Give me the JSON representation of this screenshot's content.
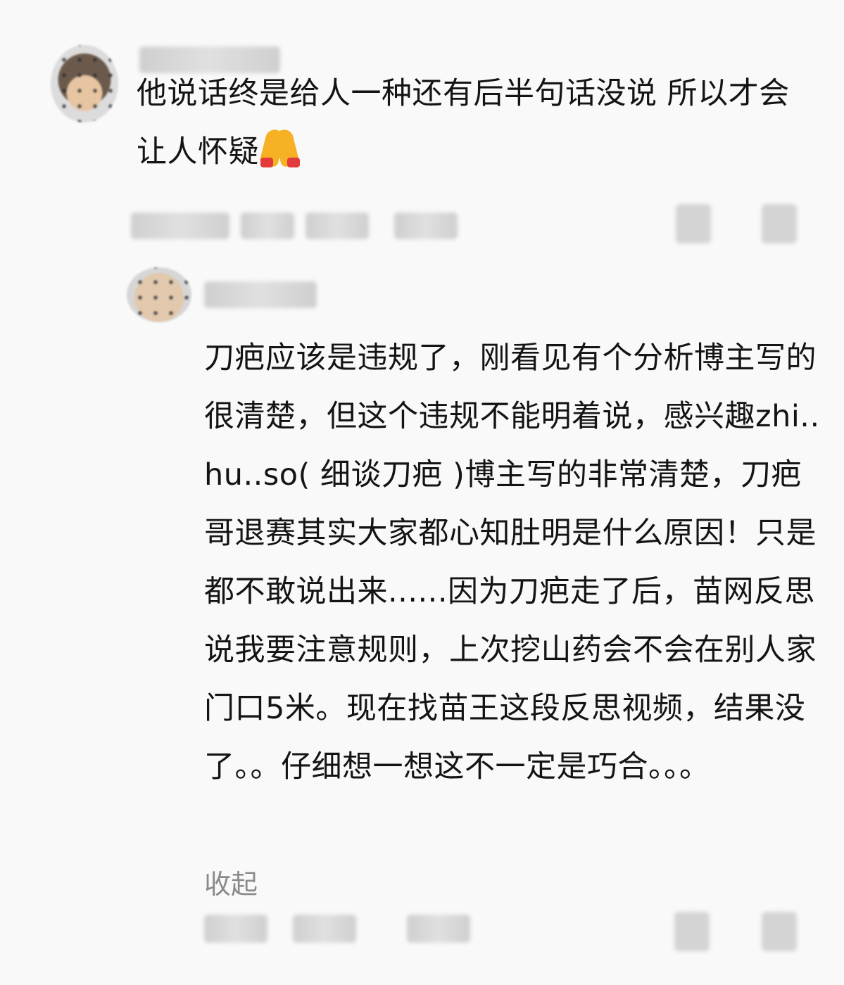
{
  "comments": {
    "top": {
      "text": "他说话终是给人一种还有后半句话没说 所以才会让人怀疑",
      "emoji": "pray-icon"
    },
    "reply": {
      "text": "刀疤应该是违规了，刚看见有个分析博主写的很清楚，但这个违规不能明着说，感兴趣zhi..hu..so( 细谈刀疤 )博主写的非常清楚，刀疤哥退赛其实大家都心知肚明是什么原因！只是都不敢说出来......因为刀疤走了后，苗网反思说我要注意规则，上次挖山药会不会在别人家门口5米。现在找苗王这段反思视频，结果没了。。仔细想一想这不一定是巧合。。。",
      "collapse_label": "收起"
    }
  },
  "colors": {
    "background": "#f9f9f9",
    "text": "#141414",
    "secondary_text": "#8a8a8a"
  }
}
